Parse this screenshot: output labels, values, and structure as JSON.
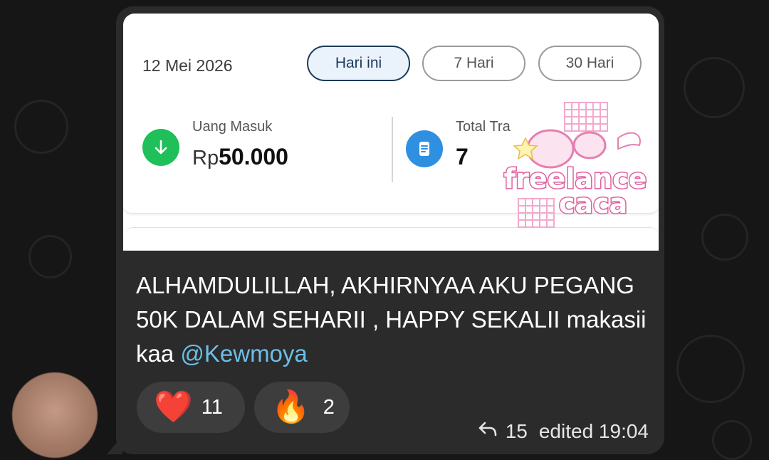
{
  "screenshot": {
    "date": "12 Mei 2026",
    "filters": [
      {
        "label": "Hari ini",
        "active": true
      },
      {
        "label": "7 Hari",
        "active": false
      },
      {
        "label": "30 Hari",
        "active": false
      }
    ],
    "income": {
      "label": "Uang Masuk",
      "currency": "Rp",
      "amount": "50.000",
      "icon": "arrow-down-icon",
      "color": "#1fbf5a"
    },
    "transactions": {
      "label": "Total Tra",
      "value": "7",
      "icon": "document-icon",
      "color": "#2f8fe0"
    },
    "sticker": {
      "text_line1": "freelance",
      "text_line2": "caca"
    }
  },
  "message": {
    "text": "ALHAMDULILLAH, AKHIRNYAA AKU PEGANG 50K DALAM SEHARII , HAPPY SEKALII makasii kaa ",
    "mention": "@Kewmoya"
  },
  "reactions": [
    {
      "emoji": "❤️",
      "name": "heart-emoji",
      "count": "11"
    },
    {
      "emoji": "🔥",
      "name": "fire-emoji",
      "count": "2"
    }
  ],
  "meta": {
    "replies": "15",
    "edited_time": "edited 19:04"
  },
  "colors": {
    "background": "#161616",
    "bubble": "#2b2b2b",
    "mention": "#6bbfe8"
  }
}
